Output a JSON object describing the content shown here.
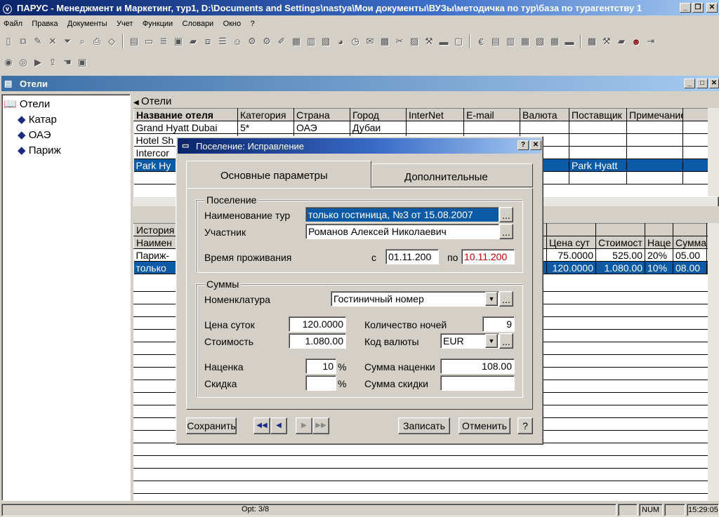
{
  "app": {
    "title": "ПАРУС - Менеджмент и Маркетинг, тур1, D:\\Documents and Settings\\nastya\\Мои документы\\ВУЗы\\методичка по тур\\база по турагентству 1"
  },
  "menu": [
    "Файл",
    "Правка",
    "Документы",
    "Учет",
    "Функции",
    "Словари",
    "Окно",
    "?"
  ],
  "child": {
    "title": "Отели"
  },
  "tree": {
    "root": "Отели",
    "items": [
      "Катар",
      "ОАЭ",
      "Париж"
    ]
  },
  "hotels": {
    "header_title": "Отели",
    "columns": [
      "Название отеля",
      "Категория",
      "Страна",
      "Город",
      "InterNet",
      "E-mail",
      "Валюта",
      "Поставщик",
      "Примечание"
    ],
    "rows": [
      [
        "Grand Hyatt Dubai",
        "5*",
        "ОАЭ",
        "Дубаи",
        "",
        "",
        "",
        "",
        ""
      ],
      [
        "Hotel Sh",
        "",
        "",
        "",
        "",
        "",
        "",
        "",
        ""
      ],
      [
        "Intercor",
        "",
        "",
        "",
        "",
        "",
        "",
        "",
        ""
      ],
      [
        "Park Hy",
        "",
        "",
        "",
        "",
        "",
        "R",
        "Park Hyatt",
        ""
      ]
    ]
  },
  "history": {
    "left_cols": [
      "История",
      "Наимен"
    ],
    "left_rows": [
      "Париж-",
      "только"
    ],
    "columns": [
      "Цена сут",
      "Стоимост",
      "Наце",
      "Сумма"
    ],
    "rows": [
      [
        "75.0000",
        "525.00",
        "20%",
        "05.00"
      ],
      [
        "120.0000",
        "1.080.00",
        "10%",
        "08.00"
      ]
    ]
  },
  "dialog": {
    "title": "Поселение: Исправление",
    "tab_main": "Основные параметры",
    "tab_extra": "Дополнительные",
    "group1": "Поселение",
    "tour_label": "Наименование тур",
    "tour_value": "только гостиница, №3 от 15.08.2007",
    "member_label": "Участник",
    "member_value": "Романов Алексей Николаевич",
    "stay_label": "Время проживания",
    "from_label": "с",
    "from_value": "01.11.200",
    "to_label": "по",
    "to_value": "10.11.200",
    "group2": "Суммы",
    "nomen_label": "Номенклатура",
    "nomen_value": "Гостиничный номер",
    "price_label": "Цена суток",
    "price_value": "120.0000",
    "nights_label": "Количество ночей",
    "nights_value": "9",
    "cost_label": "Стоимость",
    "cost_value": "1.080.00",
    "currency_label": "Код валюты",
    "currency_value": "EUR",
    "markup_label": "Наценка",
    "markup_value": "10",
    "pct": "%",
    "markup_sum_label": "Сумма наценки",
    "markup_sum_value": "108.00",
    "discount_label": "Скидка",
    "discount_value": "",
    "discount_sum_label": "Сумма скидки",
    "discount_sum_value": "",
    "save_button": "Сохранить",
    "write_button": "Записать",
    "cancel_button": "Отменить",
    "help_button": "?"
  },
  "status": {
    "center": "Opt: 3/8",
    "num": "NUM",
    "time": "15:29:05"
  },
  "colors": {
    "title_active": "#0a246a",
    "selection": "#0a5aa5",
    "red_value": "#c00000"
  }
}
